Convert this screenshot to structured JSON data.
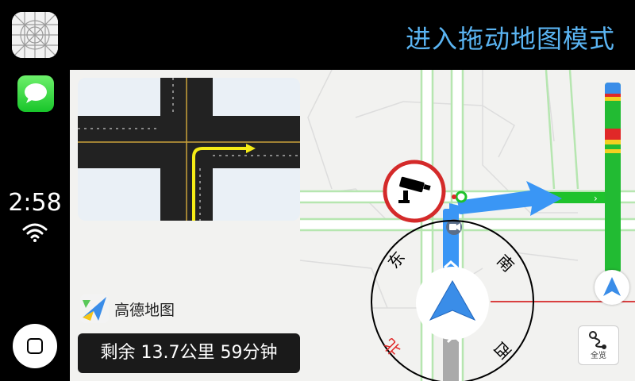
{
  "sidebar": {
    "clock": "2:58",
    "apps": [
      {
        "name": "maps"
      },
      {
        "name": "messages"
      }
    ]
  },
  "header": {
    "drag_mode_label": "进入拖动地图模式"
  },
  "map": {
    "logo_text": "高德地图",
    "remaining_info": "剩余 13.7公里 59分钟",
    "overview_label": "全览",
    "compass": {
      "east": "东",
      "south": "南",
      "west": "西",
      "north": "北"
    },
    "traffic_colors": {
      "clear": "#22bb33",
      "slow": "#f2d021",
      "jam": "#e02828",
      "start": "#3a8de8"
    },
    "route_color": "#3a96f5",
    "camera_badge": "camera-icon"
  }
}
